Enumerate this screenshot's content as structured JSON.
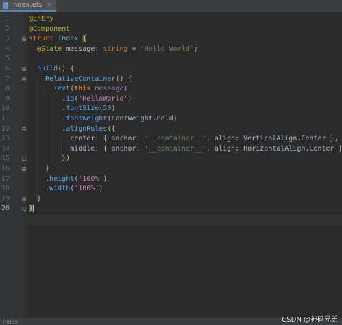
{
  "tab": {
    "filename": "Index.ets",
    "close_glyph": "×",
    "icon": "ets-file-icon"
  },
  "gutter": {
    "line_numbers": [
      "1",
      "2",
      "3",
      "4",
      "5",
      "6",
      "7",
      "8",
      "9",
      "10",
      "11",
      "12",
      "13",
      "14",
      "15",
      "16",
      "17",
      "18",
      "19",
      "20"
    ],
    "current_line": "20"
  },
  "editor": {
    "lines": [
      [
        {
          "t": "@Entry",
          "c": "annot"
        }
      ],
      [
        {
          "t": "@Component",
          "c": "annot"
        }
      ],
      [
        {
          "t": "struct ",
          "c": "kw"
        },
        {
          "t": "Index",
          "c": "class"
        },
        {
          "t": " ",
          "c": "plain"
        },
        {
          "t": "{",
          "c": "brace-hl"
        }
      ],
      [
        {
          "t": "  ",
          "c": "plain"
        },
        {
          "t": "@State",
          "c": "annot"
        },
        {
          "t": " message: ",
          "c": "ident"
        },
        {
          "t": "string",
          "c": "kw"
        },
        {
          "t": " = ",
          "c": "plain"
        },
        {
          "t": "'Hello World'",
          "c": "str"
        },
        {
          "t": ";",
          "c": "plain"
        }
      ],
      [],
      [
        {
          "t": "  ",
          "c": "plain"
        },
        {
          "t": "build",
          "c": "fn"
        },
        {
          "t": "() {",
          "c": "brace"
        }
      ],
      [
        {
          "t": "    ",
          "c": "plain"
        },
        {
          "t": "RelativeContainer",
          "c": "fn"
        },
        {
          "t": "() {",
          "c": "brace"
        }
      ],
      [
        {
          "t": "      ",
          "c": "plain"
        },
        {
          "t": "Text",
          "c": "fn"
        },
        {
          "t": "(",
          "c": "plain"
        },
        {
          "t": "this",
          "c": "this"
        },
        {
          "t": ".",
          "c": "plain"
        },
        {
          "t": "message",
          "c": "field"
        },
        {
          "t": ")",
          "c": "plain"
        }
      ],
      [
        {
          "t": "        .",
          "c": "plain"
        },
        {
          "t": "id",
          "c": "fn"
        },
        {
          "t": "(",
          "c": "plain"
        },
        {
          "t": "'HelloWorld'",
          "c": "strp"
        },
        {
          "t": ")",
          "c": "plain"
        }
      ],
      [
        {
          "t": "        .",
          "c": "plain"
        },
        {
          "t": "fontSize",
          "c": "fn"
        },
        {
          "t": "(",
          "c": "plain"
        },
        {
          "t": "50",
          "c": "num"
        },
        {
          "t": ")",
          "c": "plain"
        }
      ],
      [
        {
          "t": "        .",
          "c": "plain"
        },
        {
          "t": "fontWeight",
          "c": "fn"
        },
        {
          "t": "(FontWeight.Bold)",
          "c": "plain"
        }
      ],
      [
        {
          "t": "        .",
          "c": "plain"
        },
        {
          "t": "alignRules",
          "c": "fn"
        },
        {
          "t": "({",
          "c": "brace"
        }
      ],
      [
        {
          "t": "          center: { anchor: ",
          "c": "plain"
        },
        {
          "t": "'__container__'",
          "c": "str"
        },
        {
          "t": ", align: VerticalAlign.Center },",
          "c": "plain"
        }
      ],
      [
        {
          "t": "          middle: { anchor: ",
          "c": "plain"
        },
        {
          "t": "'__container__'",
          "c": "str"
        },
        {
          "t": ", align: HorizontalAlign.Center }",
          "c": "plain"
        }
      ],
      [
        {
          "t": "        })",
          "c": "brace"
        }
      ],
      [
        {
          "t": "    }",
          "c": "brace"
        }
      ],
      [
        {
          "t": "    .",
          "c": "plain"
        },
        {
          "t": "height",
          "c": "fn"
        },
        {
          "t": "(",
          "c": "plain"
        },
        {
          "t": "'100%'",
          "c": "strp"
        },
        {
          "t": ")",
          "c": "plain"
        }
      ],
      [
        {
          "t": "    .",
          "c": "plain"
        },
        {
          "t": "width",
          "c": "fn"
        },
        {
          "t": "(",
          "c": "plain"
        },
        {
          "t": "'100%'",
          "c": "strp"
        },
        {
          "t": ")",
          "c": "plain"
        }
      ],
      [
        {
          "t": "  }",
          "c": "brace"
        }
      ],
      [
        {
          "t": "}",
          "c": "brace-hl"
        }
      ]
    ]
  },
  "fold_markers": [
    "3",
    "6",
    "7",
    "12",
    "15",
    "16",
    "19",
    "20"
  ],
  "statusbar": {
    "left_text": "Index"
  },
  "watermark": "CSDN @神码兄弟",
  "colors": {
    "background": "#2b2b2b",
    "gutter": "#313335",
    "accent": "#4a88c7"
  }
}
